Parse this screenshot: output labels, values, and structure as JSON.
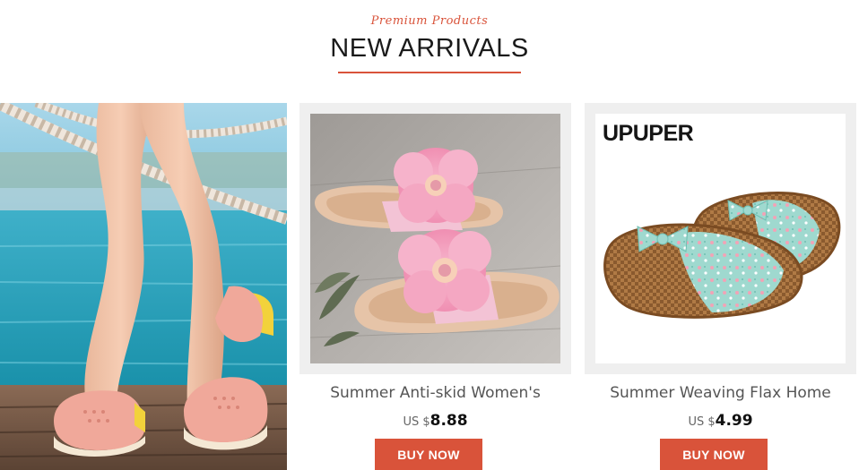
{
  "header": {
    "subtitle": "Premium Products",
    "title": "NEW ARRIVALS"
  },
  "banner": {
    "image": "woman-wearing-pink-clogs-on-pier"
  },
  "products": [
    {
      "name": "Summer Anti-skid Women's",
      "currency": "US $",
      "price": "8.88",
      "button": "BUY NOW",
      "image": "pink-flower-slides"
    },
    {
      "name": "Summer Weaving Flax Home",
      "currency": "US $",
      "price": "4.99",
      "button": "BUY NOW",
      "brand": "UPUPER",
      "image": "woven-flax-bow-slippers"
    }
  ],
  "colors": {
    "accent": "#d9533a",
    "card_bg": "#efefef"
  }
}
